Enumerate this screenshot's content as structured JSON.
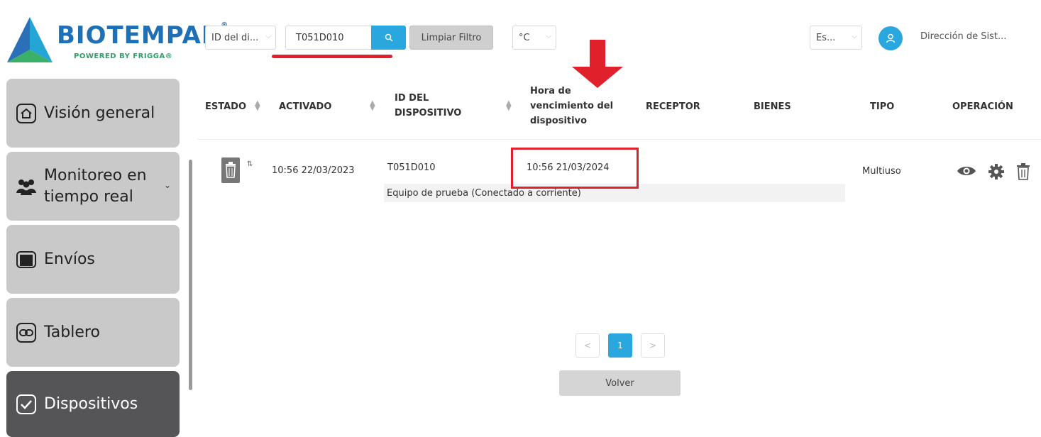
{
  "header": {
    "brand_name": "BIOTEMPAK",
    "brand_reg": "®",
    "brand_sub": "POWERED BY FRIGGA®",
    "filter_field": "ID del di...",
    "search_value": "T051D010",
    "clear_button": "Limpiar Filtro",
    "unit": "°C",
    "language": "Es...",
    "user_name": "Dirección de Sist..."
  },
  "sidebar": {
    "items": [
      {
        "label": "Visión general",
        "icon": "home-icon"
      },
      {
        "label": "Monitoreo en",
        "label2": "tiempo real",
        "icon": "people-icon"
      },
      {
        "label": "Envíos",
        "icon": "shipment-icon"
      },
      {
        "label": "Tablero",
        "icon": "link-icon"
      },
      {
        "label": "Dispositivos",
        "icon": "check-icon",
        "active": true
      }
    ]
  },
  "table": {
    "columns": {
      "estado": "ESTADO",
      "activado": "ACTIVADO",
      "id1": "ID DEL",
      "id2": "DISPOSITIVO",
      "hora1": "Hora de",
      "hora2": "vencimiento del",
      "hora3": "dispositivo",
      "receptor": "RECEPTOR",
      "bienes": "BIENES",
      "tipo": "TIPO",
      "operacion": "OPERACIÓN"
    },
    "rows": [
      {
        "status_icon": "trash-status-icon",
        "activated": "10:56 22/03/2023",
        "device_id": "T051D010",
        "expiry": "10:56 21/03/2024",
        "receptor": "",
        "bienes": "",
        "tipo": "Multiuso",
        "description": "Equipo de prueba (Conectado a corriente)"
      }
    ]
  },
  "pagination": {
    "prev": "<",
    "current": "1",
    "next": ">"
  },
  "back_button": "Volver",
  "colors": {
    "accent": "#2aa7df",
    "highlight": "#e0202a",
    "sidebar_bg": "#c9c9c9",
    "sidebar_active": "#555558"
  }
}
